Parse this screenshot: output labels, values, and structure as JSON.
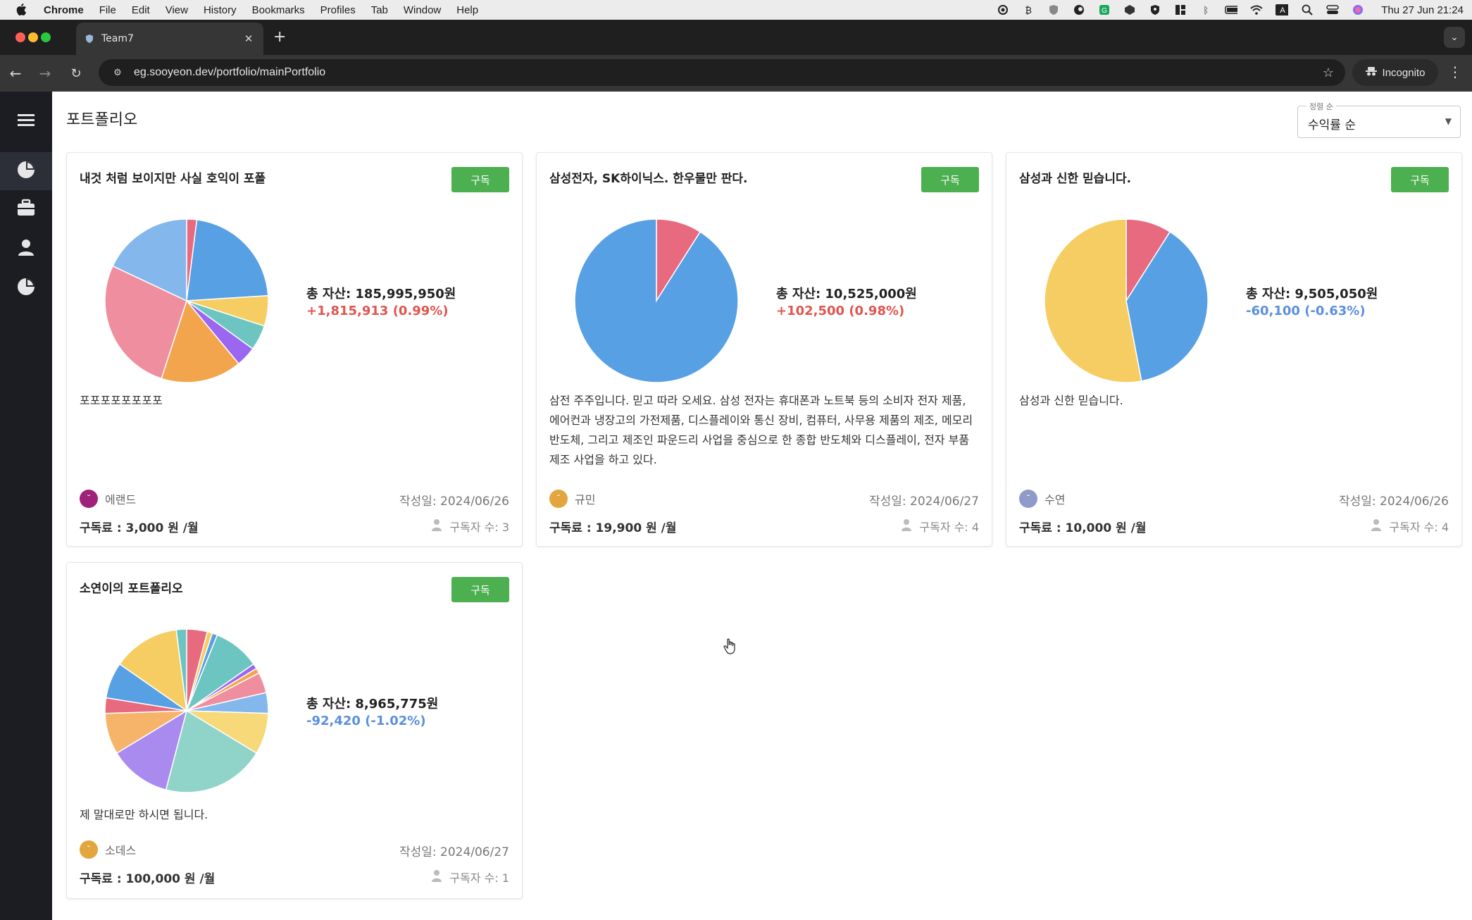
{
  "menubar": {
    "app": "Chrome",
    "items": [
      "File",
      "Edit",
      "View",
      "History",
      "Bookmarks",
      "Profiles",
      "Tab",
      "Window",
      "Help"
    ],
    "clock": "Thu 27 Jun  21:24",
    "status_icons": [
      "record-icon",
      "script-icon",
      "shield-icon",
      "ring-icon",
      "grammarly-icon",
      "cube-icon",
      "vpn-icon",
      "grid-icon",
      "bluetooth-icon",
      "battery-icon",
      "wifi-icon",
      "keyboard-a-icon",
      "spotlight-icon",
      "control-center-icon",
      "siri-icon"
    ],
    "keyboard_letter": "A"
  },
  "browser": {
    "tab_title": "Team7",
    "url": "eg.sooyeon.dev/portfolio/mainPortfolio",
    "incognito_label": "Incognito"
  },
  "sidebar": {
    "items": [
      "pie-chart-icon",
      "briefcase-icon",
      "person-icon",
      "pie-chart-icon"
    ]
  },
  "page": {
    "title": "포트폴리오",
    "sort": {
      "label": "정렬 순",
      "value": "수익률 순"
    }
  },
  "colors": {
    "subscribe_button": "#4caf50",
    "gain": "#e0554f",
    "loss": "#5b8fde",
    "sidebar": "#1b1d23"
  },
  "cards": [
    {
      "title": "내것 처럼 보이지만 사실 호익이 포폴",
      "subscribe_label": "구독",
      "total": "총 자산: 185,995,950원",
      "change": "+1,815,913 (0.99%)",
      "change_color": "#e0554f",
      "description": "포포포포포포포포",
      "author": "에랜드",
      "author_color": "#a0217a",
      "date": "작성일: 2024/06/26",
      "fee": "구독료 : 3,000 원 /월",
      "subscribers": "구독자 수: 3",
      "pie": [
        {
          "value": 2,
          "color": "#e86a7f"
        },
        {
          "value": 22,
          "color": "#58a0e4"
        },
        {
          "value": 6,
          "color": "#f6cd62"
        },
        {
          "value": 5,
          "color": "#6cc5c0"
        },
        {
          "value": 4,
          "color": "#9b66f0"
        },
        {
          "value": 16,
          "color": "#f2a54c"
        },
        {
          "value": 27,
          "color": "#ef8e9f"
        },
        {
          "value": 18,
          "color": "#84b8ec"
        }
      ]
    },
    {
      "title": "삼성전자, SK하이닉스. 한우물만 판다.",
      "subscribe_label": "구독",
      "total": "총 자산: 10,525,000원",
      "change": "+102,500 (0.98%)",
      "change_color": "#e0554f",
      "description": "삼전 주주입니다. 믿고 따라 오세요. 삼성 전자는 휴대폰과 노트북 등의 소비자 전자 제품, 에어컨과 냉장고의 가전제품, 디스플레이와 통신 장비, 컴퓨터, 사무용 제품의 제조, 메모리 반도체, 그리고 제조인 파운드리 사업을 중심으로 한 종합 반도체와 디스플레이, 전자 부품 제조 사업을 하고 있다.",
      "author": "규민",
      "author_color": "#e3a53d",
      "date": "작성일: 2024/06/27",
      "fee": "구독료 : 19,900 원 /월",
      "subscribers": "구독자 수: 4",
      "pie": [
        {
          "value": 9,
          "color": "#e86a7f"
        },
        {
          "value": 91,
          "color": "#58a0e4"
        }
      ]
    },
    {
      "title": "삼성과 신한 믿습니다.",
      "subscribe_label": "구독",
      "total": "총 자산: 9,505,050원",
      "change": "-60,100 (-0.63%)",
      "change_color": "#5b8fde",
      "description": "삼성과 신한 믿습니다.",
      "author": "수연",
      "author_color": "#8f9ac9",
      "date": "작성일: 2024/06/26",
      "fee": "구독료 : 10,000 원 /월",
      "subscribers": "구독자 수: 4",
      "pie": [
        {
          "value": 9,
          "color": "#e86a7f"
        },
        {
          "value": 38,
          "color": "#58a0e4"
        },
        {
          "value": 53,
          "color": "#f6cd62"
        }
      ]
    },
    {
      "title": "소연이의 포트폴리오",
      "subscribe_label": "구독",
      "total": "총 자산: 8,965,775원",
      "change": "-92,420 (-1.02%)",
      "change_color": "#5b8fde",
      "description": "제 말대로만 하시면 됩니다.",
      "author": "소데스",
      "author_color": "#e3a53d",
      "date": "작성일: 2024/06/27",
      "fee": "구독료 : 100,000 원 /월",
      "subscribers": "구독자 수: 1",
      "pie": [
        {
          "value": 4,
          "color": "#e86a7f"
        },
        {
          "value": 1,
          "color": "#f6cd62"
        },
        {
          "value": 1,
          "color": "#58a0e4"
        },
        {
          "value": 9,
          "color": "#6cc5c0"
        },
        {
          "value": 1,
          "color": "#9b66f0"
        },
        {
          "value": 1,
          "color": "#f2a54c"
        },
        {
          "value": 4,
          "color": "#ef8e9f"
        },
        {
          "value": 4,
          "color": "#84b8ec"
        },
        {
          "value": 8,
          "color": "#f7d97a"
        },
        {
          "value": 20,
          "color": "#8fd3c9"
        },
        {
          "value": 12,
          "color": "#a98bf0"
        },
        {
          "value": 8,
          "color": "#f5b46a"
        },
        {
          "value": 3,
          "color": "#e86a7f"
        },
        {
          "value": 7,
          "color": "#58a0e4"
        },
        {
          "value": 13,
          "color": "#f6cd62"
        },
        {
          "value": 2,
          "color": "#6cc5c0"
        }
      ]
    }
  ]
}
